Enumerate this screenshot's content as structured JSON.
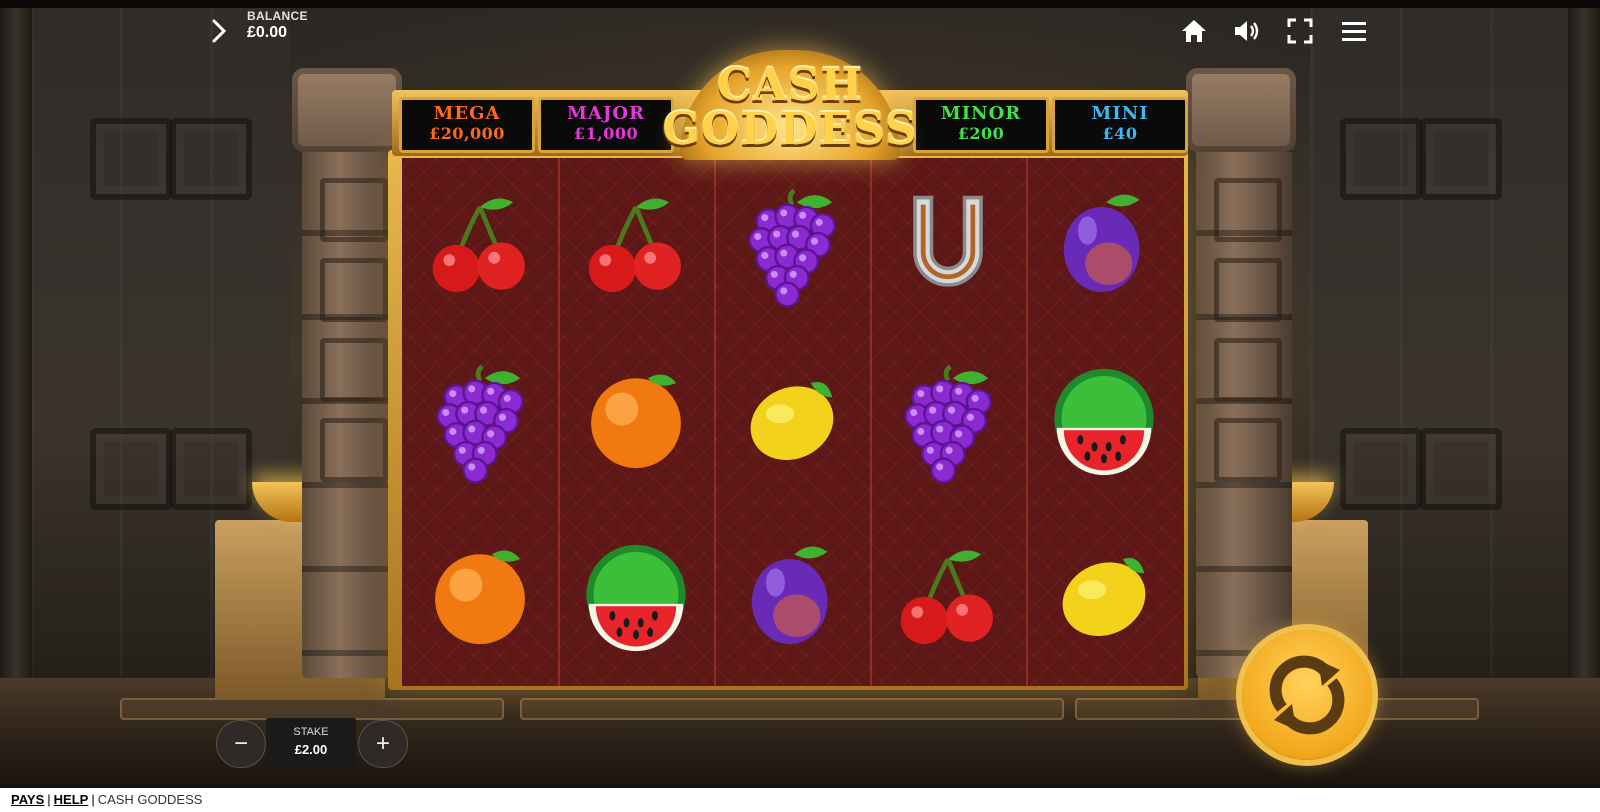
{
  "balance": {
    "label": "BALANCE",
    "value": "£0.00"
  },
  "jackpots": [
    {
      "name": "MEGA",
      "value": "£20,000",
      "color": "#ff6a1a"
    },
    {
      "name": "MAJOR",
      "value": "£1,000",
      "color": "#e23ad8"
    },
    {
      "name": "MINOR",
      "value": "£200",
      "color": "#3fe24a"
    },
    {
      "name": "MINI",
      "value": "£40",
      "color": "#3fb8f0"
    }
  ],
  "logo": {
    "line1": "CASH",
    "line2": "GODDESS"
  },
  "grid": [
    [
      "cherry",
      "cherry",
      "grapes",
      "horseshoe",
      "plum"
    ],
    [
      "grapes",
      "orange",
      "lemon",
      "grapes",
      "watermelon"
    ],
    [
      "orange",
      "watermelon",
      "plum",
      "cherry",
      "lemon"
    ]
  ],
  "stake": {
    "label": "STAKE",
    "value": "£2.00"
  },
  "icons": {
    "menu": "menu-icon",
    "home": "home-icon",
    "sound": "sound-icon",
    "fullscreen": "fullscreen-icon",
    "expand": "chevron-right-icon",
    "spin": "spin-icon"
  },
  "footer": {
    "pays": "PAYS",
    "help": "HELP",
    "sep": "|",
    "game_name": "CASH GODDESS"
  }
}
